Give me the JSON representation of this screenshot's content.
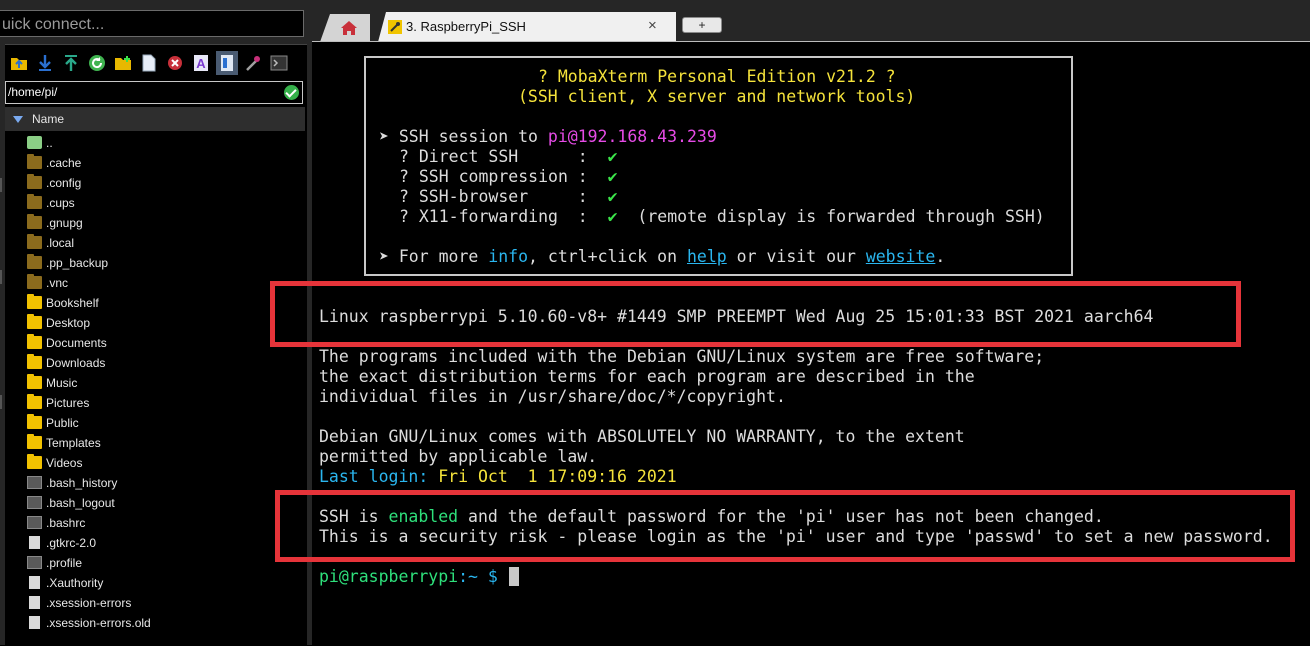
{
  "quick_connect": {
    "placeholder": "uick connect..."
  },
  "file_browser": {
    "path": "/home/pi/",
    "column_name": "Name",
    "items": [
      {
        "name": "..",
        "type": "up"
      },
      {
        "name": ".cache",
        "type": "hidden-folder"
      },
      {
        "name": ".config",
        "type": "hidden-folder"
      },
      {
        "name": ".cups",
        "type": "hidden-folder"
      },
      {
        "name": ".gnupg",
        "type": "hidden-folder"
      },
      {
        "name": ".local",
        "type": "hidden-folder"
      },
      {
        "name": ".pp_backup",
        "type": "hidden-folder"
      },
      {
        "name": ".vnc",
        "type": "hidden-folder"
      },
      {
        "name": "Bookshelf",
        "type": "folder"
      },
      {
        "name": "Desktop",
        "type": "folder"
      },
      {
        "name": "Documents",
        "type": "folder"
      },
      {
        "name": "Downloads",
        "type": "folder"
      },
      {
        "name": "Music",
        "type": "folder"
      },
      {
        "name": "Pictures",
        "type": "folder"
      },
      {
        "name": "Public",
        "type": "folder"
      },
      {
        "name": "Templates",
        "type": "folder"
      },
      {
        "name": "Videos",
        "type": "folder"
      },
      {
        "name": ".bash_history",
        "type": "shell-file"
      },
      {
        "name": ".bash_logout",
        "type": "shell-file"
      },
      {
        "name": ".bashrc",
        "type": "shell-file"
      },
      {
        "name": ".gtkrc-2.0",
        "type": "file"
      },
      {
        "name": ".profile",
        "type": "shell-file"
      },
      {
        "name": ".Xauthority",
        "type": "file"
      },
      {
        "name": ".xsession-errors",
        "type": "file"
      },
      {
        "name": ".xsession-errors.old",
        "type": "file"
      }
    ],
    "toolbar_icons": [
      "parent-folder-icon",
      "download-icon",
      "upload-icon",
      "refresh-icon",
      "new-folder-icon",
      "new-file-icon",
      "delete-icon",
      "rename-icon",
      "follow-terminal-icon",
      "magic-wand-icon",
      "terminal-icon"
    ]
  },
  "tabs": {
    "home_icon": "home-icon",
    "active_label": "3. RaspberryPi_SSH",
    "close": "×",
    "add": "+"
  },
  "terminal": {
    "banner": {
      "title": "? MobaXterm Personal Edition v21.2 ?",
      "subtitle": "(SSH client, X server and network tools)",
      "session_prefix": "➤ SSH session to ",
      "session_target": "pi@192.168.43.239",
      "features": [
        {
          "label": "? Direct SSH      :  ",
          "mark": "✔",
          "note": ""
        },
        {
          "label": "? SSH compression :  ",
          "mark": "✔",
          "note": ""
        },
        {
          "label": "? SSH-browser     :  ",
          "mark": "✔",
          "note": ""
        },
        {
          "label": "? X11-forwarding  :  ",
          "mark": "✔",
          "note": "  (remote display is forwarded through SSH)"
        }
      ],
      "info_prefix": "➤ For more ",
      "info_word": "info",
      "info_mid": ", ctrl+click on ",
      "help_word": "help",
      "info_or": " or visit our ",
      "website_word": "website",
      "info_end": "."
    },
    "uname": "Linux raspberrypi 5.10.60-v8+ #1449 SMP PREEMPT Wed Aug 25 15:01:33 BST 2021 aarch64",
    "motd": [
      "The programs included with the Debian GNU/Linux system are free software;",
      "the exact distribution terms for each program are described in the",
      "individual files in /usr/share/doc/*/copyright."
    ],
    "warranty": [
      "Debian GNU/Linux comes with ABSOLUTELY NO WARRANTY, to the extent",
      "permitted by applicable law."
    ],
    "last_login_label": "Last login:",
    "last_login_value": " Fri Oct  1 17:09:16 2021",
    "ssh_line_prefix": "SSH is ",
    "ssh_enabled": "enabled",
    "ssh_line_suffix": " and the default password for the 'pi' user has not been changed.",
    "risk_line": "This is a security risk - please login as the 'pi' user and type 'passwd' to set a new password.",
    "prompt_user": "pi@raspberrypi",
    "prompt_path": ":~",
    "prompt_symbol": " $ "
  },
  "colors": {
    "highlight": "#e6343a",
    "banner_title": "#f5e33b",
    "session_target": "#e64be6",
    "link": "#2ab6ef",
    "enabled": "#2ee07b",
    "check": "#3be44a"
  }
}
